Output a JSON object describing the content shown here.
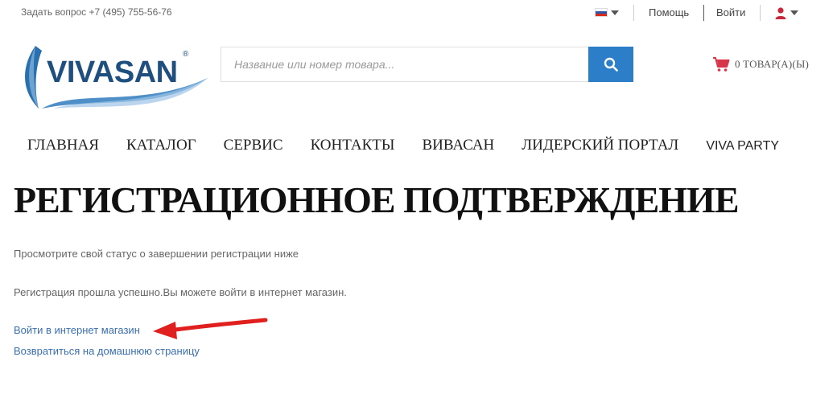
{
  "topbar": {
    "ask_text": "Задать вопрос +7 (495) 755-56-76",
    "help_label": "Помощь",
    "login_label": "Войти",
    "language_icon": "russia-flag-icon",
    "user_icon": "user-icon"
  },
  "header": {
    "logo_text": "VIVASAN",
    "logo_mark": "®",
    "search": {
      "placeholder": "Название или номер товара...",
      "value": ""
    },
    "cart_text": "0 ТОВАР(А)(Ы)"
  },
  "nav": {
    "items": [
      "ГЛАВНАЯ",
      "КАТАЛОГ",
      "СЕРВИС",
      "КОНТАКТЫ",
      "ВИВАСАН",
      "ЛИДЕРСКИЙ ПОРТАЛ",
      "VIVA PARTY"
    ]
  },
  "main": {
    "title": "РЕГИСТРАЦИОННОЕ ПОДТВЕРЖДЕНИЕ",
    "status_hint": "Просмотрите свой статус о завершении регистрации ниже",
    "success_text": "Регистрация прошла успешно.Вы можете войти в интернет магазин.",
    "login_link": "Войти в интернет магазин",
    "home_link": "Возвратиться на домашнюю страницу"
  },
  "colors": {
    "accent_blue": "#2d7ec8",
    "link_blue": "#3a6fb0",
    "logo_navy": "#1f4f7f",
    "cart_red": "#d6354a",
    "arrow_red": "#e0201e"
  }
}
